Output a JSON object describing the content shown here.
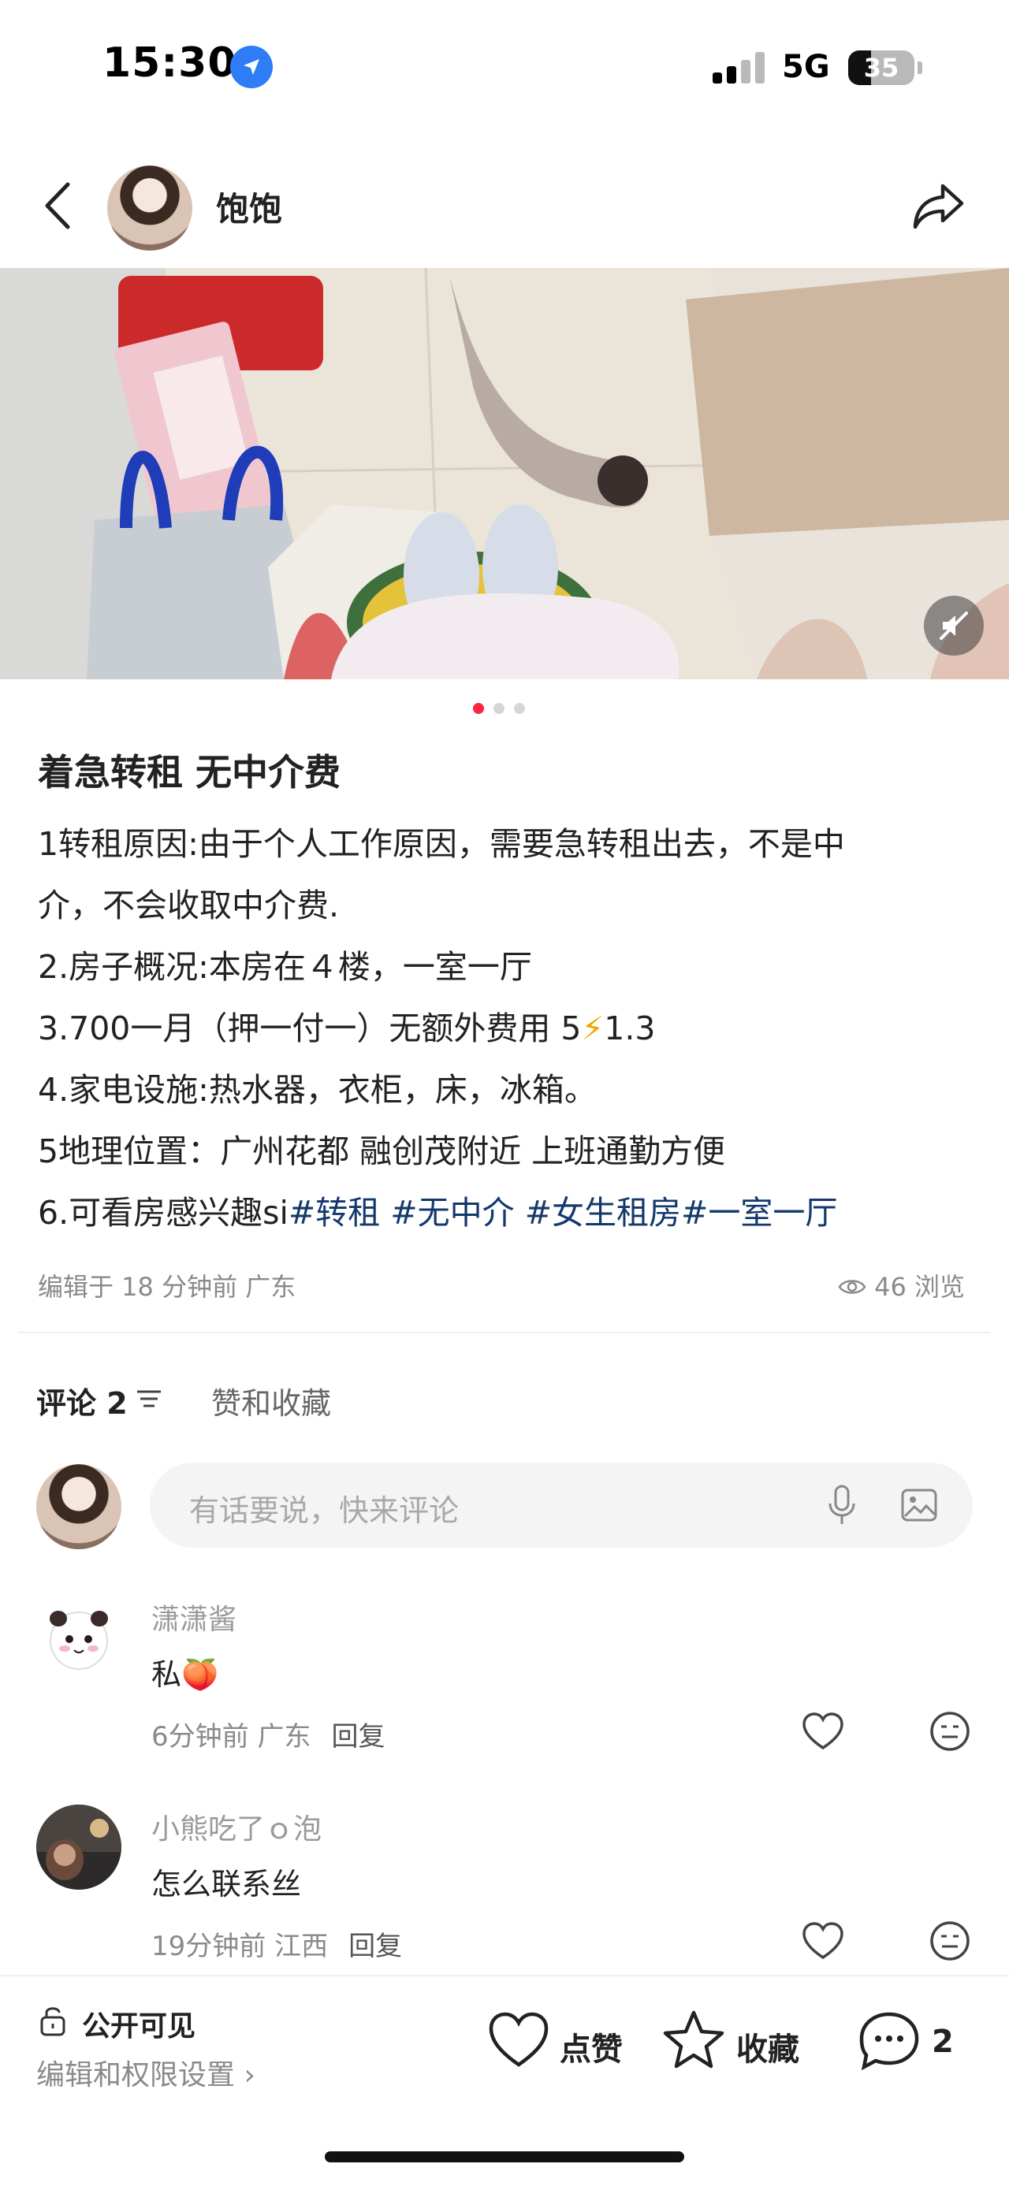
{
  "status_bar": {
    "time": "15:30",
    "network": "5G",
    "battery": "35",
    "battery_level": 0.35
  },
  "header": {
    "author_name": "饱饱",
    "icons": [
      "back-icon",
      "share-icon"
    ]
  },
  "carousel": {
    "count": 3,
    "active_index": 0,
    "mute_icon": "mute-icon"
  },
  "post": {
    "title": "着急转租 无中介费",
    "lines": [
      "1转租原因:由于个人工作原因，需要急转租出去，不是中",
      "介，不会收取中介费.",
      "2.房子概况:本房在４楼，一室一厅",
      "4.家电设施:热水器，衣柜，床，冰箱。",
      "5地理位置：广州花都 融创茂附近 上班通勤方便"
    ],
    "line3_text_a": "3.700一月（押一付一）无额外费用 5",
    "line3_emoji": "⚡",
    "line3_text_b": "1.3",
    "line6_prefix": "6.可看房感兴趣si",
    "hashtags": [
      "#转租",
      "#无中介",
      "#女生租房",
      "#一室一厅"
    ],
    "edited": "编辑于 18 分钟前 广东",
    "views_count": "46",
    "views_label": "浏览"
  },
  "comments_section": {
    "tab_comments": "评论 2",
    "tab_likes": "赞和收藏",
    "input_placeholder": "有话要说，快来评论",
    "items": [
      {
        "user": "潇潇酱",
        "text": "私",
        "emoji": "🍑",
        "time_loc": "6分钟前 广东",
        "reply": "回复"
      },
      {
        "user": "小熊吃了ｏ泡",
        "text": "怎么联系丝",
        "time_loc": "19分钟前 江西",
        "reply": "回复"
      }
    ]
  },
  "bottom_bar": {
    "visibility": "公开可见",
    "permission": "编辑和权限设置 ›",
    "like": "点赞",
    "favorite": "收藏",
    "comment_count": "2"
  },
  "colors": {
    "accent": "#ff2442",
    "hashtag": "#13386c",
    "location_blue": "#2e7cf6"
  }
}
